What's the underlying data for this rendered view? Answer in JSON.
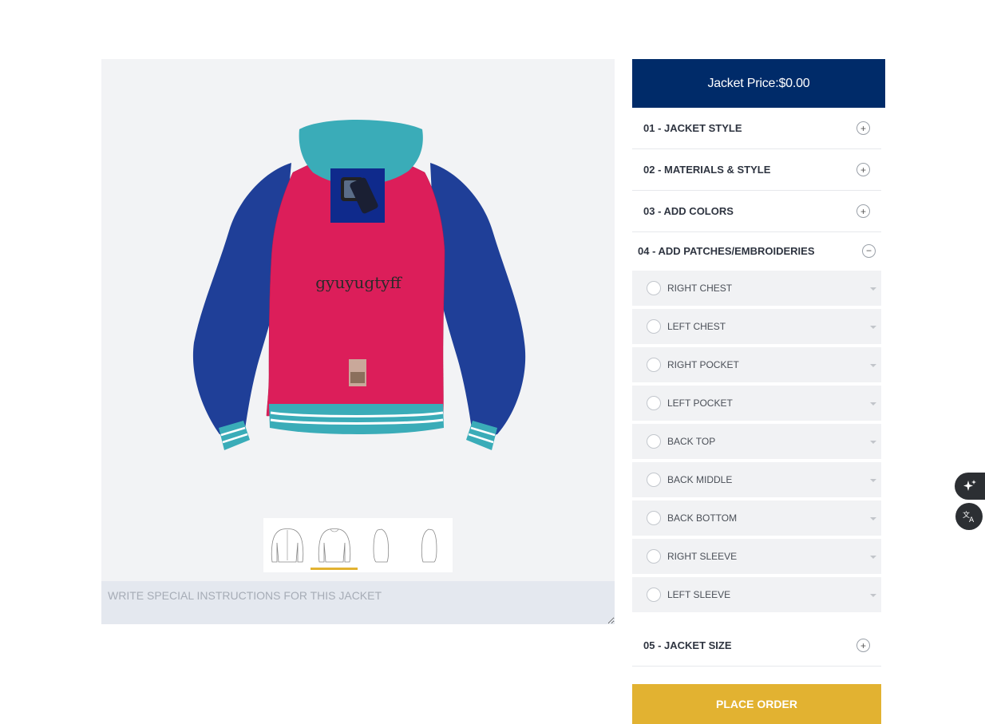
{
  "price": {
    "label": "Jacket Price:$0.00"
  },
  "design": {
    "text_patch": "gyuyugtyff",
    "colors": {
      "body": "#dc1e5a",
      "sleeves": "#1f3f98",
      "hood": "#3aacb8",
      "rib": "#3aacb8"
    }
  },
  "thumbnails": [
    {
      "name": "front",
      "active": false
    },
    {
      "name": "back",
      "active": true
    },
    {
      "name": "right-side",
      "active": false
    },
    {
      "name": "left-side",
      "active": false
    }
  ],
  "instructions": {
    "placeholder": "WRITE SPECIAL INSTRUCTIONS FOR THIS JACKET"
  },
  "steps": {
    "s1": {
      "label": "01 - JACKET STYLE",
      "toggle": "+"
    },
    "s2": {
      "label": "02 - MATERIALS & STYLE",
      "toggle": "+"
    },
    "s3": {
      "label": "03 - ADD COLORS",
      "toggle": "+"
    },
    "s4": {
      "label": "04 - ADD PATCHES/EMBROIDERIES",
      "toggle": "−"
    },
    "s5": {
      "label": "05 - JACKET SIZE",
      "toggle": "+"
    }
  },
  "placements": [
    "RIGHT CHEST",
    "LEFT CHEST",
    "RIGHT POCKET",
    "LEFT POCKET",
    "BACK TOP",
    "BACK MIDDLE",
    "BACK BOTTOM",
    "RIGHT SLEEVE",
    "LEFT SLEEVE"
  ],
  "order_button": "PLACE ORDER",
  "accent_colors": {
    "navy": "#002b69",
    "gold": "#e2b231"
  },
  "floating_icons": [
    "sparkle-icon",
    "translate-icon"
  ]
}
